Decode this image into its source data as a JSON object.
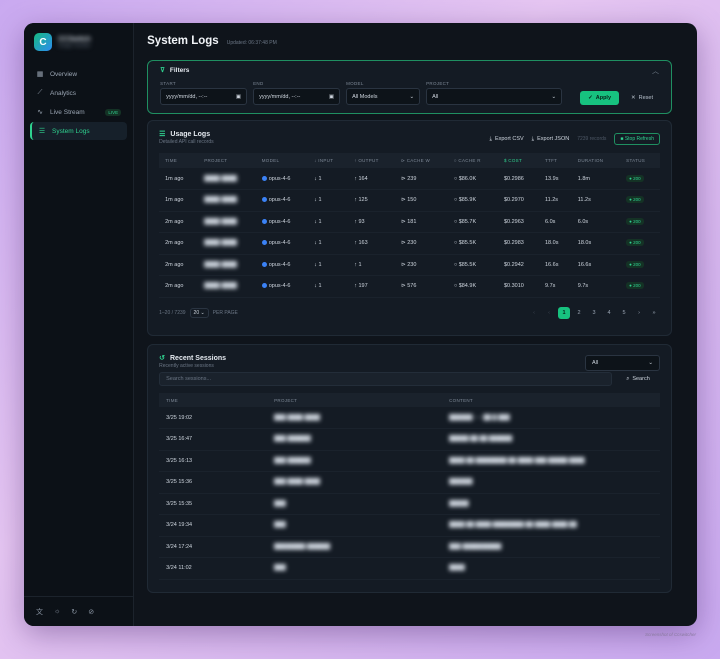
{
  "brand": {
    "name": "CCSwitch",
    "sub": "Usage monitor"
  },
  "nav": [
    {
      "label": "Overview",
      "icon": "grid-icon"
    },
    {
      "label": "Analytics",
      "icon": "chart-line-icon"
    },
    {
      "label": "Live Stream",
      "icon": "pulse-icon",
      "badge": "LIVE"
    },
    {
      "label": "System Logs",
      "icon": "list-icon",
      "active": true
    }
  ],
  "header": {
    "title": "System Logs",
    "updated": "Updated: 06:37:48 PM"
  },
  "filters": {
    "title": "Filters",
    "start_label": "START",
    "start_value": "yyyy/mm/dd, --:--",
    "end_label": "END",
    "end_value": "yyyy/mm/dd, --:--",
    "model_label": "MODEL",
    "model_value": "All Models",
    "project_label": "PROJECT",
    "project_value": "All",
    "apply": "Apply",
    "reset": "Reset"
  },
  "usage": {
    "title": "Usage Logs",
    "subtitle": "Detailed API call records",
    "export_csv": "Export CSV",
    "export_json": "Export JSON",
    "records": "7239 records",
    "stop_refresh": "Stop Refresh",
    "columns": [
      "TIME",
      "PROJECT",
      "MODEL",
      "↓ INPUT",
      "↑ OUTPUT",
      "⊳ CACHE W",
      "○ CACHE R",
      "$ COST",
      "TTFT",
      "DURATION",
      "STATUS"
    ],
    "rows": [
      {
        "time": "1m ago",
        "project": "████ ████",
        "model": "opus-4-6",
        "input": "↓ 1",
        "output": "↑ 164",
        "cache_w": "⊳ 239",
        "cache_r": "○ $86.0K",
        "cost": "$0.2986",
        "ttft": "13.9s",
        "duration": "1.8m",
        "status": "200"
      },
      {
        "time": "1m ago",
        "project": "████ ████",
        "model": "opus-4-6",
        "input": "↓ 1",
        "output": "↑ 125",
        "cache_w": "⊳ 150",
        "cache_r": "○ $85.9K",
        "cost": "$0.2970",
        "ttft": "11.2s",
        "duration": "11.2s",
        "status": "200"
      },
      {
        "time": "2m ago",
        "project": "████ ████",
        "model": "opus-4-6",
        "input": "↓ 1",
        "output": "↑ 93",
        "cache_w": "⊳ 181",
        "cache_r": "○ $85.7K",
        "cost": "$0.2963",
        "ttft": "6.0s",
        "duration": "6.0s",
        "status": "200"
      },
      {
        "time": "2m ago",
        "project": "████ ████",
        "model": "opus-4-6",
        "input": "↓ 1",
        "output": "↑ 163",
        "cache_w": "⊳ 230",
        "cache_r": "○ $85.5K",
        "cost": "$0.2983",
        "ttft": "18.0s",
        "duration": "18.0s",
        "status": "200"
      },
      {
        "time": "2m ago",
        "project": "████ ████",
        "model": "opus-4-6",
        "input": "↓ 1",
        "output": "↑ 1",
        "cache_w": "⊳ 230",
        "cache_r": "○ $85.5K",
        "cost": "$0.2942",
        "ttft": "16.6s",
        "duration": "16.6s",
        "status": "200"
      },
      {
        "time": "2m ago",
        "project": "████ ████",
        "model": "opus-4-6",
        "input": "↓ 1",
        "output": "↑ 197",
        "cache_w": "⊳ 576",
        "cache_r": "○ $84.9K",
        "cost": "$0.3010",
        "ttft": "9.7s",
        "duration": "9.7s",
        "status": "200"
      }
    ],
    "ttft_colors": [
      "red",
      "red",
      "yellow",
      "red",
      "red",
      "yellow"
    ],
    "range": "1–20 / 7239",
    "per_page": "20",
    "per_page_label": "PER PAGE",
    "pages": [
      "‹",
      "‹",
      "1",
      "2",
      "3",
      "4",
      "5",
      "›",
      "»"
    ]
  },
  "sessions": {
    "title": "Recent Sessions",
    "subtitle": "Recently active sessions",
    "filter_value": "All",
    "search_placeholder": "Search sessions...",
    "search_button": "Search",
    "columns": [
      "TIME",
      "PROJECT",
      "CONTENT"
    ],
    "rows": [
      {
        "time": "3/25 19:02",
        "project": "███ ████ ████",
        "content": "██████ ── ██ █ ███"
      },
      {
        "time": "3/25 16:47",
        "project": "███ ██████",
        "content": "█████ ██ ██ ██████"
      },
      {
        "time": "3/25 16:13",
        "project": "███ ██████",
        "content": "████ ██ ████████ ██ ████ ███ █████ ████"
      },
      {
        "time": "3/25 15:36",
        "project": "███ ████ ████",
        "content": "██████"
      },
      {
        "time": "3/25 15:35",
        "project": "███",
        "content": "█████"
      },
      {
        "time": "3/24 19:34",
        "project": "███",
        "content": "████ ██ ████ ████████ ██ ████ ████ ██"
      },
      {
        "time": "3/24 17:24",
        "project": "████████ ██████",
        "content": "███ ██████████"
      },
      {
        "time": "3/24 11:02",
        "project": "███",
        "content": "████"
      }
    ]
  },
  "footer_icons": [
    "translate-icon",
    "sun-icon",
    "refresh-icon",
    "eye-off-icon"
  ],
  "watermark": "Screenshot of Ccswitcher",
  "colors": {
    "accent": "#17c27f",
    "bg": "#0f141b",
    "panel": "#141b24"
  }
}
